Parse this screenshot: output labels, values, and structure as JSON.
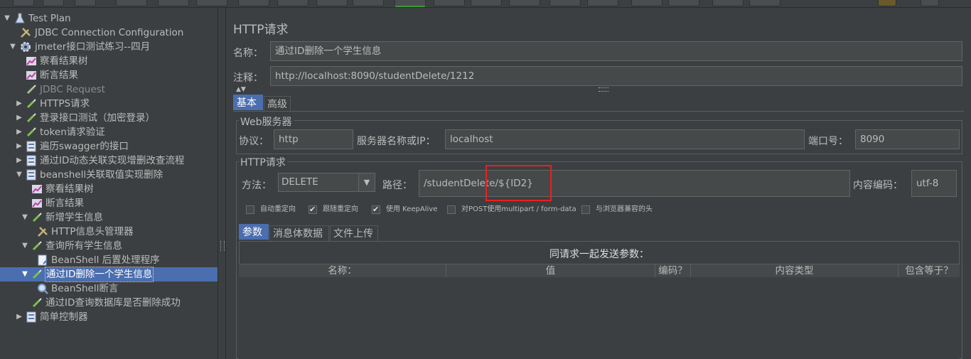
{
  "toolbar": {
    "buttons": [
      "new",
      "templates",
      "open",
      "save",
      "cut",
      "copy",
      "paste",
      "expand",
      "collapse",
      "toggle",
      "start",
      "start-no-pause",
      "stop",
      "shutdown",
      "clear",
      "clear-all",
      "search",
      "reset-search",
      "function-helper",
      "help",
      "remote-start",
      "remote-stop"
    ]
  },
  "tree": {
    "items": [
      {
        "label": "Test Plan",
        "icon": "flask-icon",
        "arrow": "down"
      },
      {
        "label": "JDBC Connection Configuration",
        "icon": "wrench-icon",
        "arrow": ""
      },
      {
        "label": "jmeter接口测试练习--四月",
        "icon": "gear-icon",
        "arrow": "down"
      },
      {
        "label": "察看结果树",
        "icon": "chart-icon",
        "arrow": ""
      },
      {
        "label": "断言结果",
        "icon": "chart-icon",
        "arrow": ""
      },
      {
        "label": "JDBC Request",
        "icon": "pipette-icon",
        "arrow": ""
      },
      {
        "label": "HTTPS请求",
        "icon": "pipette-icon",
        "arrow": "right"
      },
      {
        "label": "登录接口测试（加密登录）",
        "icon": "pipette-icon",
        "arrow": "right"
      },
      {
        "label": "token请求验证",
        "icon": "pipette-icon",
        "arrow": "right"
      },
      {
        "label": "遍历swagger的接口",
        "icon": "controller-icon",
        "arrow": "right"
      },
      {
        "label": "通过ID动态关联实现增删改查流程",
        "icon": "controller-icon",
        "arrow": "right"
      },
      {
        "label": "beanshell关联取值实现删除",
        "icon": "controller-icon",
        "arrow": "down"
      },
      {
        "label": "察看结果树",
        "icon": "chart-icon",
        "arrow": ""
      },
      {
        "label": "断言结果",
        "icon": "chart-icon",
        "arrow": ""
      },
      {
        "label": "新增学生信息",
        "icon": "pipette-icon",
        "arrow": "down"
      },
      {
        "label": "HTTP信息头管理器",
        "icon": "wrench-icon",
        "arrow": ""
      },
      {
        "label": "查询所有学生信息",
        "icon": "pipette-icon",
        "arrow": "down"
      },
      {
        "label": "BeanShell 后置处理程序",
        "icon": "script-icon",
        "arrow": ""
      },
      {
        "label": "通过ID删除一个学生信息",
        "icon": "pipette-icon",
        "arrow": "down"
      },
      {
        "label": "BeanShell断言",
        "icon": "magnifier-icon",
        "arrow": ""
      },
      {
        "label": "通过ID查询数据库是否删除成功",
        "icon": "pipette-icon",
        "arrow": ""
      },
      {
        "label": "简单控制器",
        "icon": "controller-icon",
        "arrow": "right"
      }
    ]
  },
  "panel": {
    "title": "HTTP请求",
    "name_label": "名称：",
    "name_value": "通过ID删除一个学生信息",
    "comment_label": "注释：",
    "comment_value": "http://localhost:8090/studentDelete/1212",
    "tabs": [
      "基本",
      "高级"
    ],
    "web_server": {
      "title": "Web服务器",
      "protocol_label": "协议：",
      "protocol_value": "http",
      "server_label": "服务器名称或IP：",
      "server_value": "localhost",
      "port_label": "端口号：",
      "port_value": "8090"
    },
    "http_request": {
      "title": "HTTP请求",
      "method_label": "方法：",
      "method_value": "DELETE",
      "path_label": "路径：",
      "path_value": "/studentDelete/${ID2}",
      "encoding_label": "内容编码：",
      "encoding_value": "utf-8"
    },
    "checkboxes": [
      {
        "label": "自动重定向",
        "checked": false
      },
      {
        "label": "跟随重定向",
        "checked": true
      },
      {
        "label": "使用 KeepAlive",
        "checked": true
      },
      {
        "label": "对POST使用multipart / form-data",
        "checked": false
      },
      {
        "label": "与浏览器兼容的头",
        "checked": false
      }
    ],
    "param_tabs": [
      "参数",
      "消息体数据",
      "文件上传"
    ],
    "params_caption": "同请求一起发送参数：",
    "columns": [
      "名称：",
      "值",
      "编码？",
      "内容类型",
      "包含等于？"
    ]
  },
  "colors": {
    "selection": "#4b6eaf",
    "highlight_box": "#e82020",
    "background": "#3c3f41",
    "field": "#45494a"
  }
}
